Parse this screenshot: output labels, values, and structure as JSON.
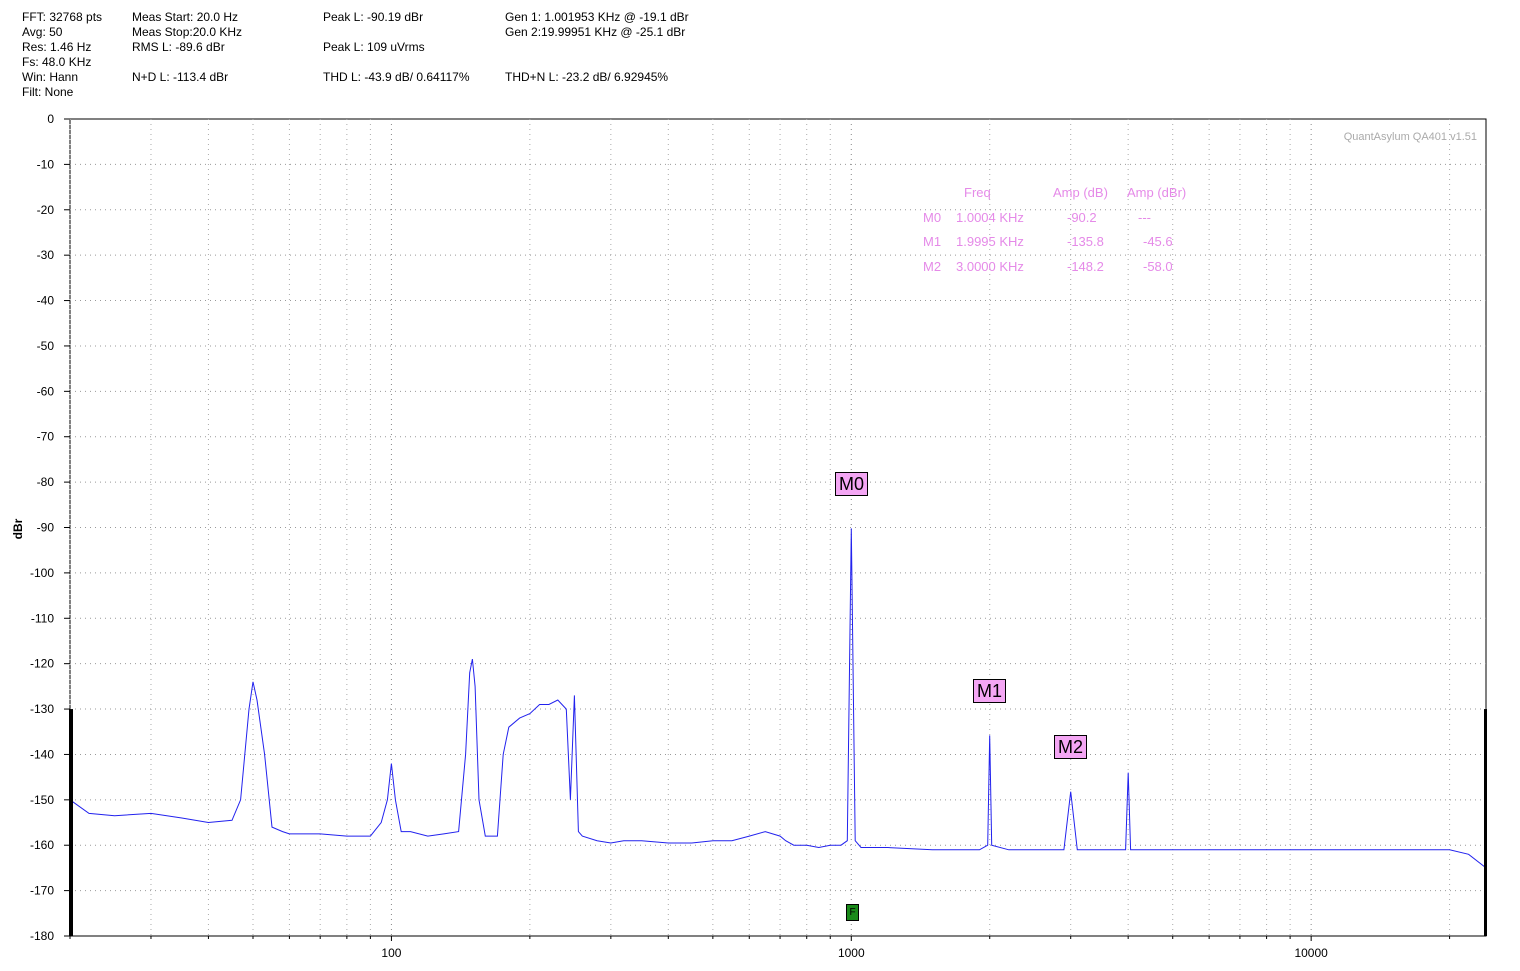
{
  "header": {
    "fft": "FFT: 32768 pts",
    "avg": "Avg: 50",
    "res": "Res: 1.46 Hz",
    "fs": "Fs: 48.0 KHz",
    "win": "Win: Hann",
    "filt": "Filt: None",
    "meas_start": "Meas Start: 20.0 Hz",
    "meas_stop": "Meas Stop:20.0 KHz",
    "rms_l": "RMS L: -89.6 dBr",
    "nd_l": "N+D L: -113.4 dBr",
    "peak_l_dbr": "Peak L: -90.19 dBr",
    "peak_l_uv": "Peak L: 109 uVrms",
    "thd_l": "THD L: -43.9 dB/ 0.64117%",
    "gen1": "Gen 1: 1.001953 KHz @ -19.1  dBr",
    "gen2": "Gen 2:19.99951 KHz @ -25.1  dBr",
    "thdn_l": "THD+N L: -23.2 dB/ 6.92945%"
  },
  "watermark": "QuantAsylum QA401 v1.51",
  "marker_table": {
    "headers": [
      "Freq",
      "Amp (dB)",
      "Amp (dBr)"
    ],
    "rows": [
      {
        "name": "M0",
        "freq": "1.0004 KHz",
        "amp_db": "-90.2",
        "amp_dbr": "---"
      },
      {
        "name": "M1",
        "freq": "1.9995 KHz",
        "amp_db": "-135.8",
        "amp_dbr": "-45.6"
      },
      {
        "name": "M2",
        "freq": "3.0000 KHz",
        "amp_db": "-148.2",
        "amp_dbr": "-58.0"
      }
    ]
  },
  "markers": [
    {
      "label": "M0",
      "freq": 1000.4,
      "amp": -90.2
    },
    {
      "label": "M1",
      "freq": 1999.5,
      "amp": -135.8
    },
    {
      "label": "M2",
      "freq": 3000.0,
      "amp": -148.2
    }
  ],
  "f_marker": {
    "label": "F",
    "freq": 1000
  },
  "chart_data": {
    "type": "line",
    "ylabel": "dBr",
    "xlabel": "",
    "x_scale": "log",
    "xlim": [
      20,
      24000
    ],
    "ylim": [
      -180,
      0
    ],
    "y_ticks": [
      0,
      -10,
      -20,
      -30,
      -40,
      -50,
      -60,
      -70,
      -80,
      -90,
      -100,
      -110,
      -120,
      -130,
      -140,
      -150,
      -160,
      -170,
      -180
    ],
    "y_tick_labels": [
      "0",
      "-10",
      "-20",
      "-30",
      "-40",
      "-50",
      "-60",
      "-70",
      "-80",
      "-90",
      "-100",
      "-110",
      "-120",
      "-130",
      "-140",
      "-150",
      "-160",
      "-170",
      "-180"
    ],
    "x_tick_labels": [
      "100",
      "1000",
      "10000"
    ],
    "grid": true,
    "series": [
      {
        "color": "#2222ee",
        "x": [
          20,
          22,
          25,
          30,
          35,
          40,
          45,
          47,
          49,
          50,
          51,
          53,
          55,
          58,
          60,
          70,
          80,
          90,
          95,
          98,
          100,
          102,
          105,
          110,
          120,
          130,
          140,
          145,
          148,
          150,
          152,
          155,
          160,
          170,
          175,
          180,
          190,
          200,
          210,
          220,
          230,
          240,
          245,
          250,
          255,
          260,
          280,
          300,
          320,
          350,
          400,
          450,
          500,
          550,
          600,
          650,
          700,
          720,
          750,
          800,
          850,
          900,
          950,
          980,
          1000,
          1020,
          1050,
          1100,
          1200,
          1500,
          1900,
          1980,
          2000,
          2020,
          2200,
          2500,
          2900,
          3000,
          3100,
          3500,
          3950,
          4000,
          4050,
          5000,
          6000,
          7000,
          8000,
          9000,
          10000,
          12000,
          15000,
          18000,
          20000,
          22000,
          24000
        ],
        "y": [
          -150,
          -153,
          -153.5,
          -153,
          -154,
          -155,
          -154.5,
          -150,
          -130,
          -124,
          -128,
          -140,
          -156,
          -157,
          -157.5,
          -157.5,
          -158,
          -158,
          -155,
          -150,
          -142,
          -150,
          -157,
          -157,
          -158,
          -157.5,
          -157,
          -140,
          -122,
          -119,
          -125,
          -150,
          -158,
          -158,
          -140,
          -134,
          -132,
          -131,
          -129,
          -129,
          -128,
          -130,
          -150,
          -127,
          -157,
          -158,
          -159,
          -159.5,
          -159,
          -159,
          -159.5,
          -159.5,
          -159,
          -159,
          -158,
          -157,
          -158,
          -159,
          -160,
          -160,
          -160.5,
          -160,
          -160,
          -159,
          -90.2,
          -159,
          -160.5,
          -160.5,
          -160.5,
          -161,
          -161,
          -160,
          -135.8,
          -160,
          -161,
          -161,
          -161,
          -148.2,
          -161,
          -161,
          -161,
          -144,
          -161,
          -161,
          -161,
          -161,
          -161,
          -161,
          -161,
          -161,
          -161,
          -161,
          -161,
          -162,
          -165
        ]
      }
    ]
  }
}
